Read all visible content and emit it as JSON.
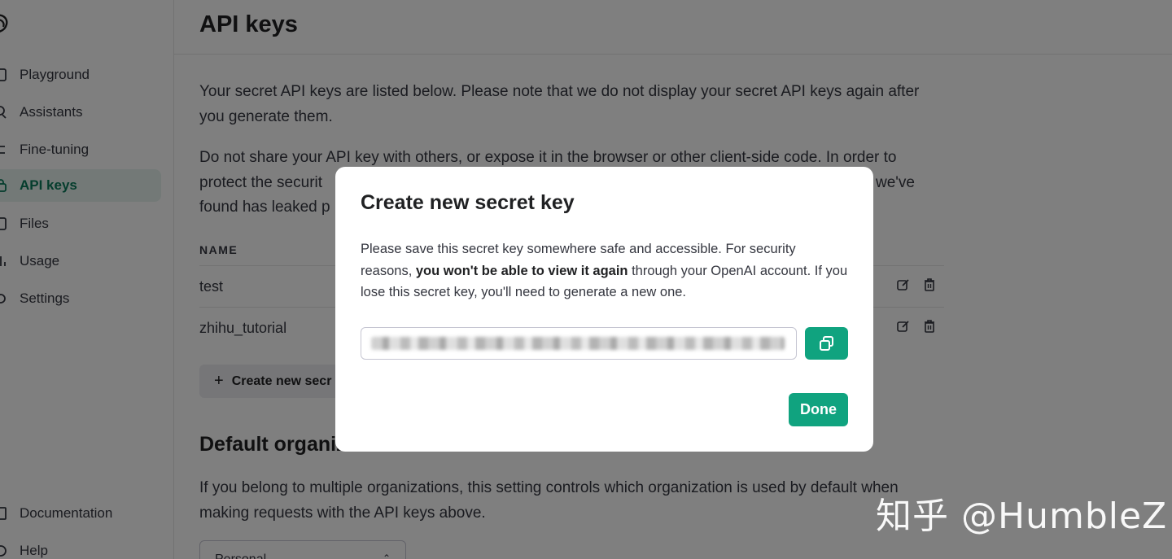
{
  "sidebar": {
    "items": [
      {
        "label": "Playground",
        "icon": "terminal-icon"
      },
      {
        "label": "Assistants",
        "icon": "person-icon"
      },
      {
        "label": "Fine-tuning",
        "icon": "tune-icon"
      },
      {
        "label": "API keys",
        "icon": "lock-icon",
        "active": true
      },
      {
        "label": "Files",
        "icon": "file-icon"
      },
      {
        "label": "Usage",
        "icon": "chart-icon"
      },
      {
        "label": "Settings",
        "icon": "gear-icon"
      }
    ],
    "bottom_items": [
      {
        "label": "Documentation",
        "icon": "book-icon"
      },
      {
        "label": "Help",
        "icon": "help-icon"
      }
    ]
  },
  "header": {
    "title": "API keys"
  },
  "main": {
    "intro1": "Your secret API keys are listed below. Please note that we do not display your secret API keys again after you generate them.",
    "intro2_line1": "Do not share your API key with others, or expose it in the browser or other client-side code. In order to",
    "intro2_line2_start": "protect the securit",
    "intro2_line2_end": "we've",
    "intro2_line3": "found has leaked p",
    "table": {
      "name_header": "NAME",
      "rows": [
        {
          "name": "test"
        },
        {
          "name": "zhihu_tutorial"
        }
      ]
    },
    "create_button": "Create new secr",
    "default_org_title": "Default organiz",
    "default_org_text": "If you belong to multiple organizations, this setting controls which organization is used by default when making requests with the API keys above.",
    "org_select_value": "Personal"
  },
  "modal": {
    "title": "Create new secret key",
    "text_before": "Please save this secret key somewhere safe and accessible. For security reasons, ",
    "text_bold": "you won't be able to view it again",
    "text_after": " through your OpenAI account. If you lose this secret key, you'll need to generate a new one.",
    "done_label": "Done"
  },
  "watermark": "知乎 @HumbleZ",
  "colors": {
    "accent": "#10a37f",
    "active_text": "#0b7a5a",
    "active_bg": "#e6f3ef"
  }
}
